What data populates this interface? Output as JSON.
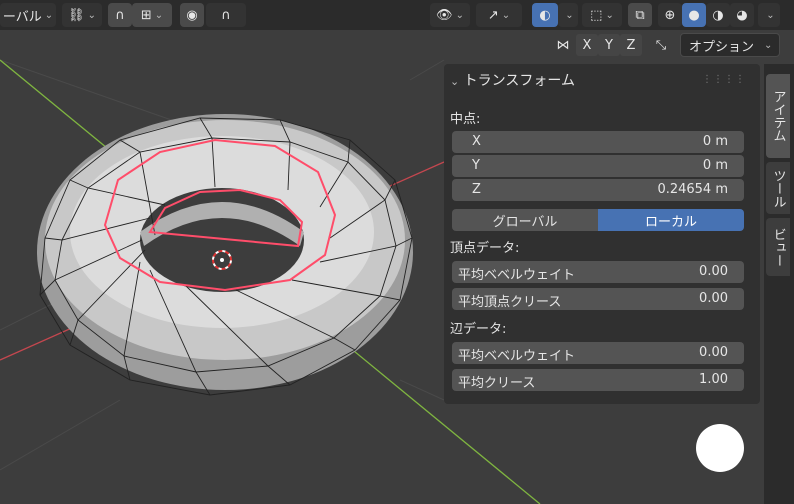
{
  "header": {
    "global_label": "ーバル",
    "buttons": [
      "link-icon",
      "magnet-icon",
      "snap-increment-icon",
      "proportional-edit-icon",
      "falloff-icon",
      "visibility-icon",
      "gizmo-icon",
      "overlay-icon",
      "xray-icon"
    ]
  },
  "axes": {
    "x": "X",
    "y": "Y",
    "z": "Z",
    "options_label": "オプション"
  },
  "panel": {
    "title": "トランスフォーム",
    "median_label": "中点:",
    "x_label": "X",
    "x_value": "0 m",
    "y_label": "Y",
    "y_value": "0 m",
    "z_label": "Z",
    "z_value": "0.24654 m",
    "global_label": "グローバル",
    "local_label": "ローカル",
    "vertex_data_label": "頂点データ:",
    "v_bevel_label": "平均ベベルウェイト",
    "v_bevel_value": "0.00",
    "v_crease_label": "平均頂点クリース",
    "v_crease_value": "0.00",
    "edge_data_label": "辺データ:",
    "e_bevel_label": "平均ベベルウェイト",
    "e_bevel_value": "0.00",
    "e_crease_label": "平均クリース",
    "e_crease_value": "1.00"
  },
  "tabs": {
    "item": "アイテム",
    "tool": "ツール",
    "view": "ビュー"
  },
  "colors": {
    "accent": "#4772b3",
    "crease": "#ff4d6a",
    "x_axis": "#c4474f",
    "y_axis": "#7fb540"
  }
}
